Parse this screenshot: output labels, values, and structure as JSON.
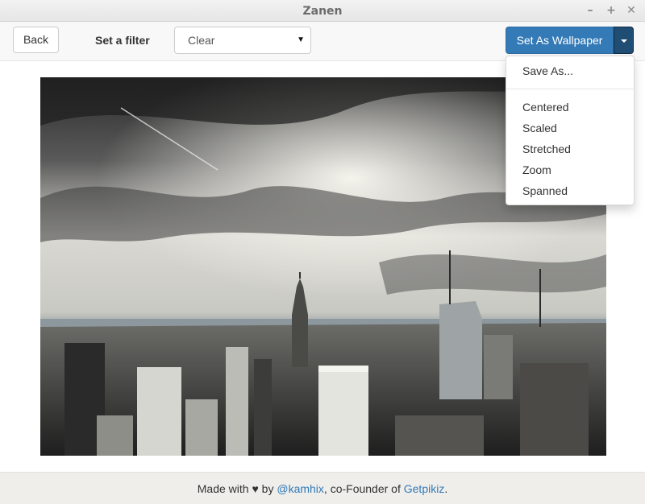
{
  "window": {
    "title": "Zanen",
    "minimize": "–",
    "maximize": "+",
    "close": "✕"
  },
  "toolbar": {
    "back_label": "Back",
    "filter_label": "Set a filter",
    "filter_value": "Clear",
    "filter_caret": "▼",
    "wallpaper_label": "Set As Wallpaper"
  },
  "dropdown": {
    "save_as": "Save As...",
    "options": [
      "Centered",
      "Scaled",
      "Stretched",
      "Zoom",
      "Spanned"
    ]
  },
  "footer": {
    "made_with": "Made with",
    "heart": "♥",
    "by": "by",
    "author": "@kamhix",
    "separator": ", co-Founder of",
    "company": "Getpikiz",
    "period": "."
  },
  "colors": {
    "primary": "#337ab7",
    "primary_dark": "#204d74",
    "footer_bg": "#efeeeb",
    "link": "#337ab7"
  }
}
